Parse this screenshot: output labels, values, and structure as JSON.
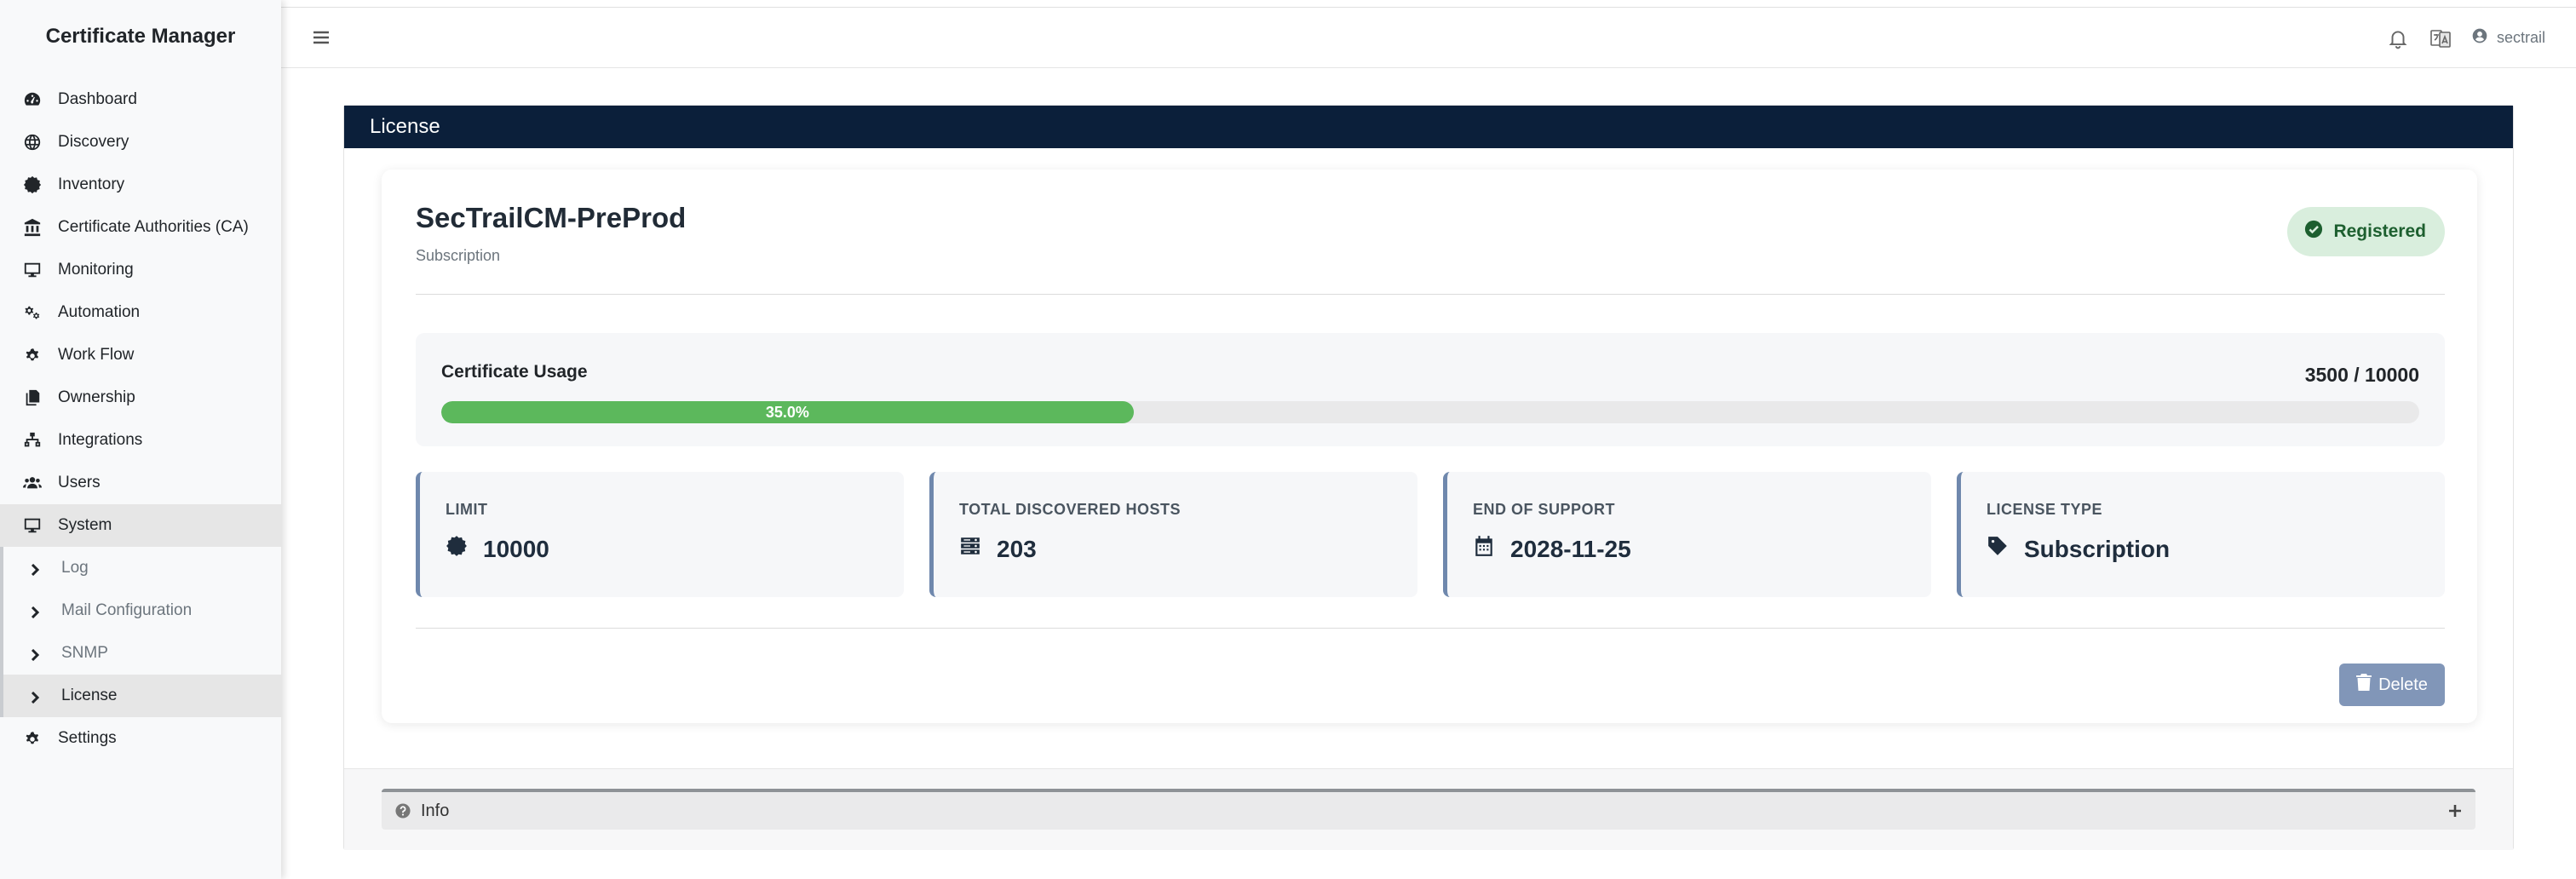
{
  "app": {
    "title": "Certificate Manager"
  },
  "sidebar": {
    "items": [
      {
        "label": "Dashboard",
        "icon": "gauge-icon"
      },
      {
        "label": "Discovery",
        "icon": "globe-icon"
      },
      {
        "label": "Inventory",
        "icon": "certificate-icon"
      },
      {
        "label": "Certificate Authorities (CA)",
        "icon": "bank-icon"
      },
      {
        "label": "Monitoring",
        "icon": "desktop-icon"
      },
      {
        "label": "Automation",
        "icon": "gears-icon"
      },
      {
        "label": "Work Flow",
        "icon": "gear-icon"
      },
      {
        "label": "Ownership",
        "icon": "copy-icon"
      },
      {
        "label": "Integrations",
        "icon": "sitemap-icon"
      },
      {
        "label": "Users",
        "icon": "users-icon"
      },
      {
        "label": "System",
        "icon": "desktop-icon"
      }
    ],
    "system_sub": [
      {
        "label": "Log"
      },
      {
        "label": "Mail Configuration"
      },
      {
        "label": "SNMP"
      },
      {
        "label": "License"
      }
    ],
    "settings": {
      "label": "Settings",
      "icon": "gear-icon"
    }
  },
  "topbar": {
    "username": "sectrail"
  },
  "page": {
    "header": "License",
    "license_name": "SecTrailCM-PreProd",
    "license_subtitle": "Subscription",
    "status_badge": "Registered",
    "usage": {
      "title": "Certificate Usage",
      "count_label": "3500 / 10000",
      "progress": 0.35,
      "percent_label": "35.0%"
    },
    "stats": [
      {
        "label": "LIMIT",
        "value": "10000",
        "icon": "certificate-icon"
      },
      {
        "label": "TOTAL DISCOVERED HOSTS",
        "value": "203",
        "icon": "server-icon"
      },
      {
        "label": "END OF SUPPORT",
        "value": "2028-11-25",
        "icon": "calendar-icon"
      },
      {
        "label": "LICENSE TYPE",
        "value": "Subscription",
        "icon": "tag-icon"
      }
    ],
    "delete_label": "Delete",
    "info_label": "Info"
  },
  "colors": {
    "header_bg": "#0b1f3a",
    "progress_fill": "#5cb85c",
    "badge_bg": "#d9eedd",
    "badge_text": "#1d5f2f",
    "stat_accent": "#6f88ad",
    "delete_bg": "#8196b8"
  }
}
